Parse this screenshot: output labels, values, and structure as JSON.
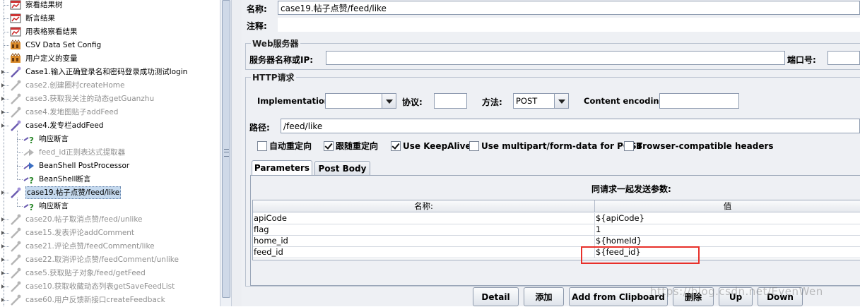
{
  "tree": {
    "items": [
      {
        "label": "察看结果树",
        "icon": "view-results-tree-icon",
        "disabled": false
      },
      {
        "label": "断言结果",
        "icon": "assertion-results-icon",
        "disabled": false
      },
      {
        "label": "用表格察看结果",
        "icon": "view-results-table-icon",
        "disabled": false
      },
      {
        "label": "CSV Data Set Config",
        "icon": "csv-config-icon",
        "disabled": false
      },
      {
        "label": "用户定义的变量",
        "icon": "user-variables-icon",
        "disabled": false
      },
      {
        "label": "Case1.输入正确登录名和密码登录成功测试login",
        "icon": "http-sampler-icon",
        "disabled": false
      },
      {
        "label": "case2.创建圈村createHome",
        "icon": "http-sampler-icon",
        "disabled": true
      },
      {
        "label": "case3.获取我关注的动态getGuanzhu",
        "icon": "http-sampler-icon",
        "disabled": true
      },
      {
        "label": "case4.发地图贴子addFeed",
        "icon": "http-sampler-icon",
        "disabled": true
      },
      {
        "label": "case4.发专栏addFeed",
        "icon": "http-sampler-icon",
        "disabled": false
      },
      {
        "label": "响应断言",
        "icon": "response-assertion-icon",
        "disabled": false
      },
      {
        "label": "feed_id正则表达式提取器",
        "icon": "regex-extractor-icon",
        "disabled": true
      },
      {
        "label": "BeanShell PostProcessor",
        "icon": "beanshell-postprocessor-icon",
        "disabled": false
      },
      {
        "label": "BeanShell断言",
        "icon": "beanshell-assertion-icon",
        "disabled": false
      },
      {
        "label": "case19.帖子点赞/feed/like",
        "icon": "http-sampler-icon",
        "disabled": false,
        "selected": true
      },
      {
        "label": "响应断言",
        "icon": "response-assertion-icon",
        "disabled": false
      },
      {
        "label": "case20.帖子取消点赞/feed/unlike",
        "icon": "http-sampler-icon",
        "disabled": true
      },
      {
        "label": "case15.发表评论addComment",
        "icon": "http-sampler-icon",
        "disabled": true
      },
      {
        "label": "case21.评论点赞/feedComment/like",
        "icon": "http-sampler-icon",
        "disabled": true
      },
      {
        "label": "case22.取消评论点赞/feedComment/unlike",
        "icon": "http-sampler-icon",
        "disabled": true
      },
      {
        "label": "case5.获取贴子对象/feed/getFeed",
        "icon": "http-sampler-icon",
        "disabled": true
      },
      {
        "label": "case10.获取收藏动态列表getSaveFeedList",
        "icon": "http-sampler-icon",
        "disabled": true
      },
      {
        "label": "case60.用户反馈新接口createFeedback",
        "icon": "http-sampler-icon",
        "disabled": true
      }
    ]
  },
  "form": {
    "name_label": "名称:",
    "name_value": "case19.帖子点赞/feed/like",
    "comment_label": "注释:",
    "web_server": {
      "title": "Web服务器",
      "server_label": "服务器名称或IP:",
      "server_value": "",
      "port_label": "端口号:",
      "port_value": ""
    },
    "http_request": {
      "title": "HTTP请求",
      "implementation_label": "Implementation:",
      "implementation_value": "",
      "protocol_label": "协议:",
      "protocol_value": "",
      "method_label": "方法:",
      "method_value": "POST",
      "encoding_label": "Content encoding:",
      "encoding_value": "",
      "path_label": "路径:",
      "path_value": "/feed/like"
    },
    "options": [
      {
        "label": "自动重定向",
        "checked": false
      },
      {
        "label": "跟随重定向",
        "checked": true
      },
      {
        "label": "Use KeepAlive",
        "checked": true
      },
      {
        "label": "Use multipart/form-data for POST",
        "checked": false
      },
      {
        "label": "Browser-compatible headers",
        "checked": false
      }
    ],
    "tabs": [
      {
        "label": "Parameters",
        "active": true
      },
      {
        "label": "Post Body",
        "active": false
      }
    ],
    "params_title": "同请求一起发送参数:",
    "params_columns": [
      "名称:",
      "值"
    ],
    "params_rows": [
      {
        "name": "apiCode",
        "value": "${apiCode}"
      },
      {
        "name": "flag",
        "value": "1"
      },
      {
        "name": "home_id",
        "value": "${homeId}"
      },
      {
        "name": "feed_id",
        "value": "${feed_id}",
        "highlighted": true
      }
    ],
    "buttons": {
      "detail": "Detail",
      "add": "添加",
      "add_clipboard": "Add from Clipboard",
      "delete": "删除",
      "up": "Up",
      "down": "Down"
    },
    "highlight_color": "#e8302a"
  },
  "watermark": "https://blog.csdn.net/EvenWen"
}
